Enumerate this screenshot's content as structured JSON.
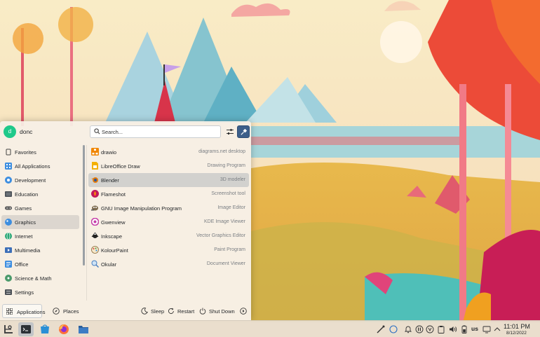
{
  "user": {
    "initial": "d",
    "name": "donc"
  },
  "search": {
    "placeholder": "Search..."
  },
  "categories": [
    {
      "label": "Favorites",
      "icon": "favorites-icon"
    },
    {
      "label": "All Applications",
      "icon": "all-applications-icon"
    },
    {
      "label": "Development",
      "icon": "development-icon"
    },
    {
      "label": "Education",
      "icon": "education-icon"
    },
    {
      "label": "Games",
      "icon": "games-icon"
    },
    {
      "label": "Graphics",
      "icon": "graphics-icon",
      "active": true
    },
    {
      "label": "Internet",
      "icon": "internet-icon"
    },
    {
      "label": "Multimedia",
      "icon": "multimedia-icon"
    },
    {
      "label": "Office",
      "icon": "office-icon"
    },
    {
      "label": "Science & Math",
      "icon": "science-icon"
    },
    {
      "label": "Settings",
      "icon": "settings-icon"
    }
  ],
  "apps": [
    {
      "name": "drawio",
      "desc": "diagrams.net desktop",
      "icon": "drawio-icon"
    },
    {
      "name": "LibreOffice Draw",
      "desc": "Drawing Program",
      "icon": "libreoffice-draw-icon"
    },
    {
      "name": "Blender",
      "desc": "3D modeler",
      "icon": "blender-icon",
      "active": true
    },
    {
      "name": "Flameshot",
      "desc": "Screenshot tool",
      "icon": "flameshot-icon"
    },
    {
      "name": "GNU Image Manipulation Program",
      "desc": "Image Editor",
      "icon": "gimp-icon"
    },
    {
      "name": "Gwenview",
      "desc": "KDE Image Viewer",
      "icon": "gwenview-icon"
    },
    {
      "name": "Inkscape",
      "desc": "Vector Graphics Editor",
      "icon": "inkscape-icon"
    },
    {
      "name": "KolourPaint",
      "desc": "Paint Program",
      "icon": "kolourpaint-icon"
    },
    {
      "name": "Okular",
      "desc": "Document Viewer",
      "icon": "okular-icon"
    }
  ],
  "footer": {
    "applications_label": "Applications",
    "places_label": "Places",
    "sleep_label": "Sleep",
    "restart_label": "Restart",
    "shutdown_label": "Shut Down"
  },
  "taskbar": {
    "tasks": [
      "app-launcher-icon",
      "terminal-icon",
      "discover-icon",
      "firefox-icon",
      "file-manager-icon"
    ],
    "keyboard_layout": "us",
    "time": "11:01 PM",
    "date": "8/12/2022"
  },
  "colors": {
    "accent": "#3d5f8a",
    "avatar": "#1fc98a",
    "panel": "#f6f0e6",
    "taskbar": "#e9decd"
  }
}
